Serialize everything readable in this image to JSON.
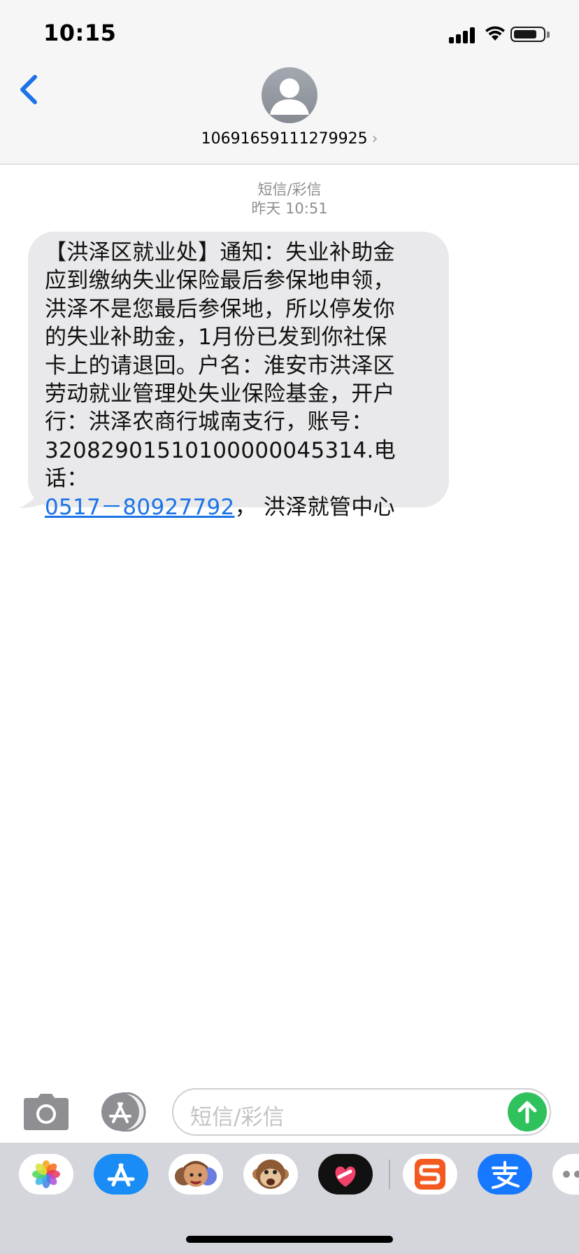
{
  "status_bar": {
    "time": "10:15",
    "battery_level": 0.8
  },
  "header": {
    "contact_number": "10691659111279925",
    "contact_chevron": "›"
  },
  "conversation": {
    "service_label": "短信/彩信",
    "timestamp": "昨天 10:51",
    "message": {
      "text_before_link": "【洪泽区就业处】通知：失业补助金\n应到缴纳失业保险最后参保地申领，\n洪泽不是您最后参保地，所以停发你\n的失业补助金，1月份已发到你社保\n卡上的请退回。户名：淮安市洪泽区\n劳动就业管理处失业保险基金，开户\n行：洪泽农商行城南支行，账号：\n32082901510100000045314.电话：\n",
      "phone_link": "0517－80927792",
      "text_after_link": "， 洪泽就管中心"
    }
  },
  "input_bar": {
    "placeholder": "短信/彩信",
    "icons": [
      "camera-icon",
      "app-store-icon",
      "send-arrow-icon"
    ]
  },
  "app_drawer": {
    "apps": [
      "photos-app",
      "app-store-app",
      "memoji-app",
      "animoji-monkey-app",
      "digital-touch-app",
      "sogou-app",
      "alipay-app",
      "more-apps"
    ]
  },
  "colors": {
    "accent": "#1b73e8",
    "bubble": "#e9e9eb",
    "send": "#2fc15b",
    "header_bg": "#f6f6f6",
    "drawer_bg": "#d4d6db"
  }
}
